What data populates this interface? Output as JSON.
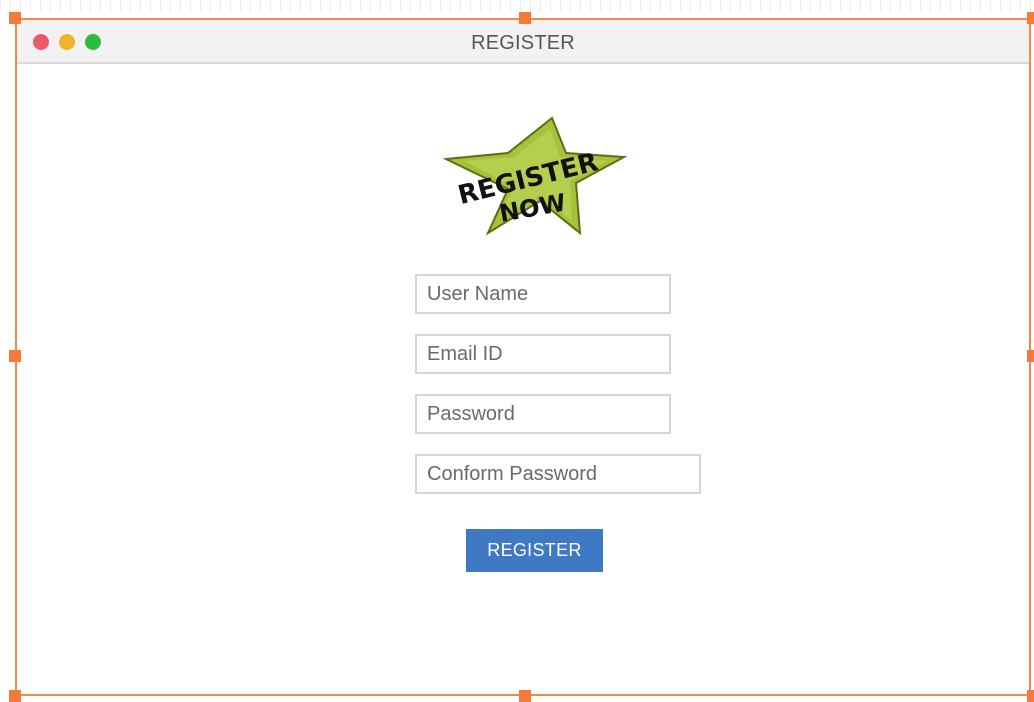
{
  "window": {
    "title": "REGISTER",
    "controls": [
      "close-dot",
      "minimize-dot",
      "maximize-dot"
    ],
    "border_color": "#f08a4b",
    "handle_color": "#f57a3a"
  },
  "logo": {
    "line1": "REGISTER",
    "line2": "NOW",
    "star_color": "#a6c13a"
  },
  "form": {
    "username_placeholder": "User Name",
    "email_placeholder": "Email ID",
    "password_placeholder": "Password",
    "confirm_placeholder": "Conform Password",
    "submit_label": "REGISTER",
    "button_color": "#3f78c3"
  }
}
